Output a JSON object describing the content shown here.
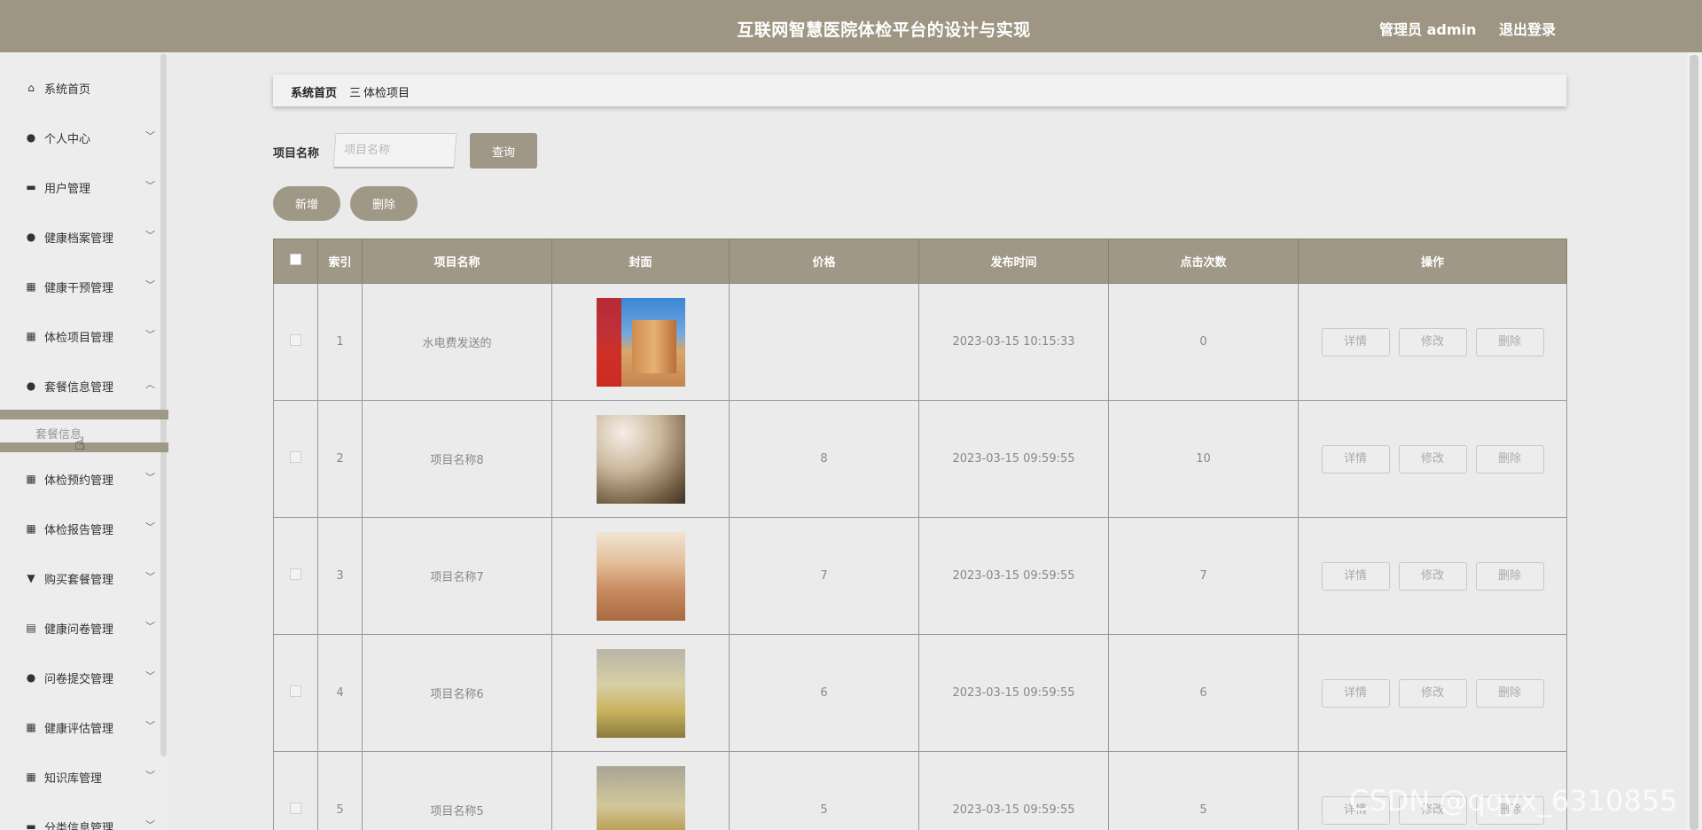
{
  "header": {
    "title": "互联网智慧医院体检平台的设计与实现",
    "user": "管理员 admin",
    "logout": "退出登录"
  },
  "sidebar": {
    "items": [
      {
        "label": "系统首页",
        "icon": "home-icon",
        "glyph": "⌂",
        "expandable": false
      },
      {
        "label": "个人中心",
        "icon": "user-icon",
        "glyph": "●",
        "expandable": true
      },
      {
        "label": "用户管理",
        "icon": "briefcase-icon",
        "glyph": "▬",
        "expandable": true
      },
      {
        "label": "健康档案管理",
        "icon": "user-icon",
        "glyph": "●",
        "expandable": true
      },
      {
        "label": "健康干预管理",
        "icon": "grid-icon",
        "glyph": "▦",
        "expandable": true
      },
      {
        "label": "体检项目管理",
        "icon": "grid-icon",
        "glyph": "▦",
        "expandable": true
      },
      {
        "label": "套餐信息管理",
        "icon": "user-icon",
        "glyph": "●",
        "expandable": true,
        "expanded": true
      },
      {
        "label": "体检预约管理",
        "icon": "grid-icon",
        "glyph": "▦",
        "expandable": true
      },
      {
        "label": "体检报告管理",
        "icon": "grid-icon",
        "glyph": "▦",
        "expandable": true
      },
      {
        "label": "购买套餐管理",
        "icon": "pin-icon",
        "glyph": "▼",
        "expandable": true
      },
      {
        "label": "健康问卷管理",
        "icon": "clipboard-icon",
        "glyph": "▤",
        "expandable": true
      },
      {
        "label": "问卷提交管理",
        "icon": "bulb-icon",
        "glyph": "●",
        "expandable": true
      },
      {
        "label": "健康评估管理",
        "icon": "grid-icon",
        "glyph": "▦",
        "expandable": true
      },
      {
        "label": "知识库管理",
        "icon": "grid-icon",
        "glyph": "▦",
        "expandable": true
      },
      {
        "label": "分类信息管理",
        "icon": "dots-icon",
        "glyph": "▬",
        "expandable": true
      }
    ],
    "sub_item": "套餐信息"
  },
  "breadcrumb": {
    "home": "系统首页",
    "separator": "三",
    "current": "体检项目"
  },
  "search": {
    "label": "项目名称",
    "placeholder": "项目名称",
    "value": "",
    "query_button": "查询"
  },
  "actions": {
    "add": "新增",
    "delete": "删除"
  },
  "table": {
    "columns": [
      "索引",
      "项目名称",
      "封面",
      "价格",
      "发布时间",
      "点击次数",
      "操作"
    ],
    "rows": [
      {
        "index": "1",
        "name": "水电费发送的",
        "price": "",
        "time": "2023-03-15 10:15:33",
        "clicks": "0"
      },
      {
        "index": "2",
        "name": "项目名称8",
        "price": "8",
        "time": "2023-03-15 09:59:55",
        "clicks": "10"
      },
      {
        "index": "3",
        "name": "项目名称7",
        "price": "7",
        "time": "2023-03-15 09:59:55",
        "clicks": "7"
      },
      {
        "index": "4",
        "name": "项目名称6",
        "price": "6",
        "time": "2023-03-15 09:59:55",
        "clicks": "6"
      },
      {
        "index": "5",
        "name": "项目名称5",
        "price": "5",
        "time": "2023-03-15 09:59:55",
        "clicks": "5"
      }
    ],
    "row_actions": {
      "detail": "详情",
      "edit": "修改",
      "delete": "删除"
    }
  },
  "watermark": "CSDN @qqyx_6310855"
}
